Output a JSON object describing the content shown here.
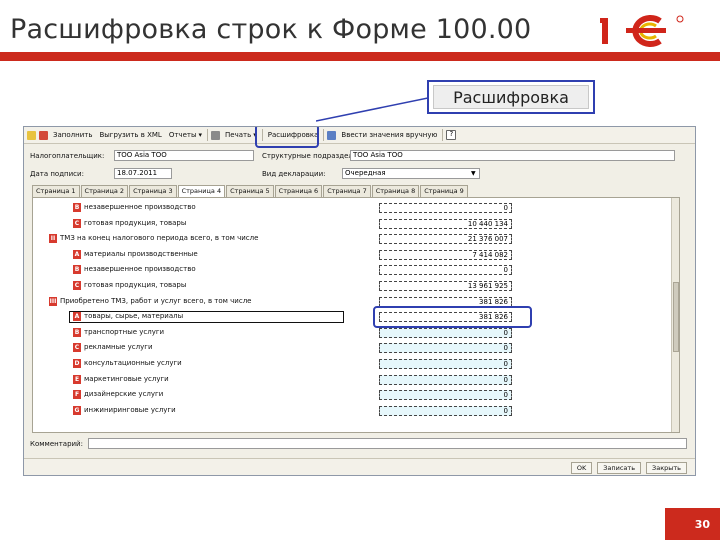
{
  "slide": {
    "title": "Расшифровка строк к Форме 100.00",
    "page_number": "30",
    "colors": {
      "accent": "#cc2a1d",
      "highlight": "#2f3fb0"
    }
  },
  "callout": {
    "label": "Расшифровка"
  },
  "toolbar": {
    "fill_label": "Заполнить",
    "upload_label": "Выгрузить в XML",
    "reports_label": "Отчеты",
    "print_label": "Печать",
    "decode_label": "Расшифровка",
    "manual_label": "Ввести значения вручную"
  },
  "header": {
    "taxpayer_label": "Налогоплательщик:",
    "taxpayer_value": "ТОО Asia TOO",
    "division_label": "Структурные подразделения:",
    "division_value": "TOO Asia TOO",
    "date_label": "Дата подписи:",
    "date_value": "18.07.2011",
    "declaration_label": "Вид декларации:",
    "declaration_value": "Очередная"
  },
  "tabs": [
    "Страница 1",
    "Страница 2",
    "Страница 3",
    "Страница 4",
    "Страница 5",
    "Страница 6",
    "Страница 7",
    "Страница 8",
    "Страница 9"
  ],
  "active_tab_index": 3,
  "rows": [
    {
      "code": "B",
      "text": "незавершенное производство",
      "value": "0"
    },
    {
      "code": "C",
      "text": "готовая продукция, товары",
      "value": "10 440 134"
    },
    {
      "code": "II",
      "text": "ТМЗ на конец налогового периода всего, в том числе",
      "value": "21 376 007"
    },
    {
      "code": "A",
      "text": "материалы производственные",
      "value": "7 414 082"
    },
    {
      "code": "B",
      "text": "незавершенное производство",
      "value": "0"
    },
    {
      "code": "C",
      "text": "готовая продукция, товары",
      "value": "13 961 925"
    },
    {
      "code": "III",
      "text": "Приобретено ТМЗ, работ и услуг всего, в том числе",
      "value": "381 826"
    },
    {
      "code": "A",
      "text": "товары, сырье, материалы",
      "value": "381 826"
    },
    {
      "code": "B",
      "text": "транспортные услуги",
      "value": "0"
    },
    {
      "code": "C",
      "text": "рекламные услуги",
      "value": "0"
    },
    {
      "code": "D",
      "text": "консультационные услуги",
      "value": "0"
    },
    {
      "code": "E",
      "text": "маркетинговые услуги",
      "value": "0"
    },
    {
      "code": "F",
      "text": "дизайнерские услуги",
      "value": "0"
    },
    {
      "code": "G",
      "text": "инжиниринговые услуги",
      "value": "0"
    }
  ],
  "comment_label": "Комментарий:",
  "footer": {
    "ok_label": "OK",
    "save_label": "Записать",
    "close_label": "Закрыть"
  }
}
